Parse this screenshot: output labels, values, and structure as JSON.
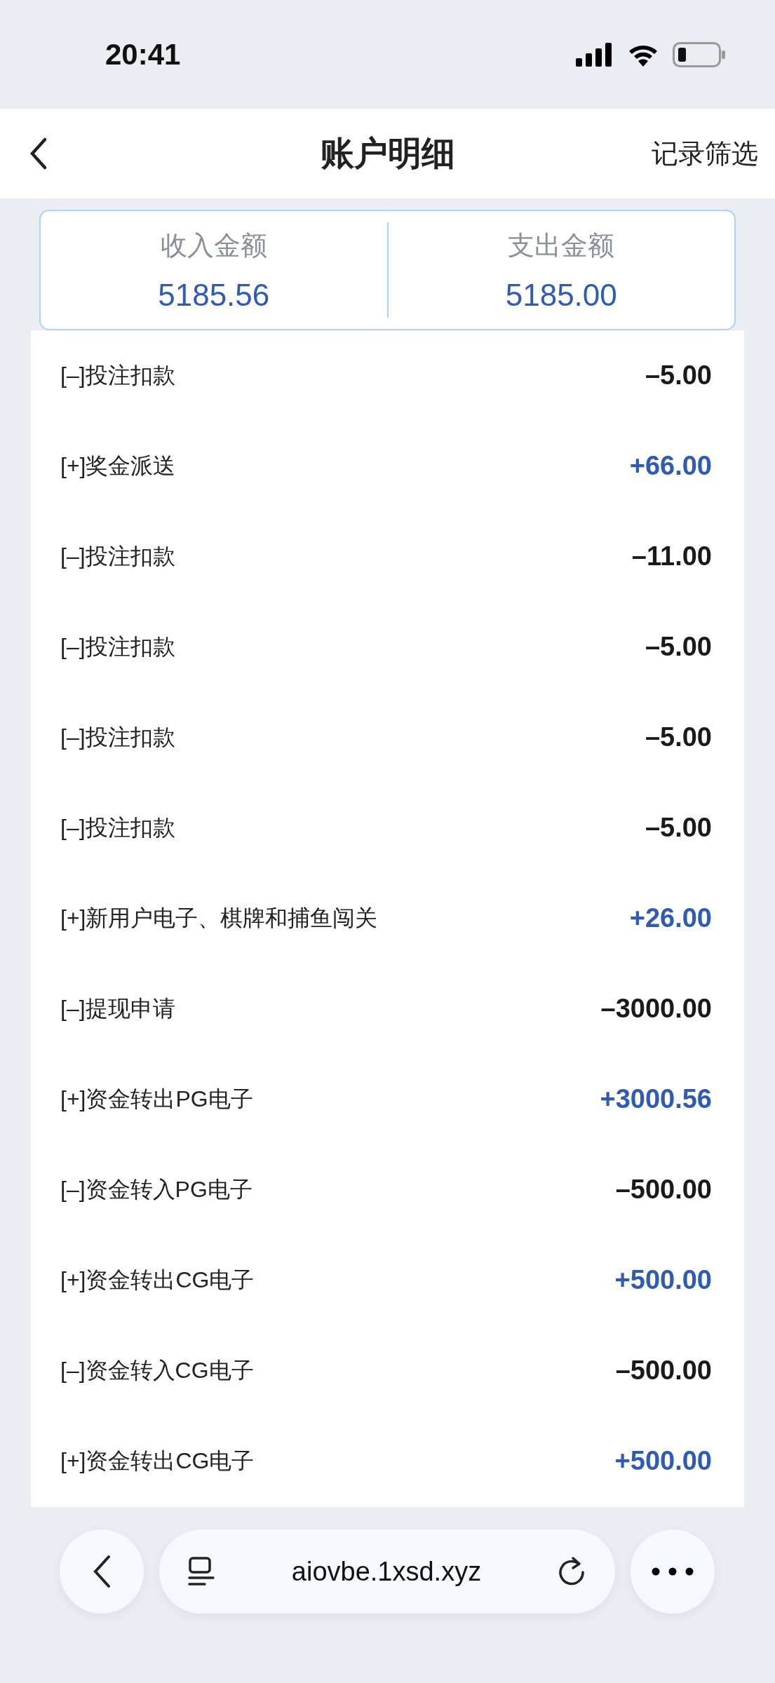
{
  "status_bar": {
    "time": "20:41"
  },
  "header": {
    "title": "账户明细",
    "action": "记录筛选"
  },
  "summary": [
    {
      "label": "收入金额",
      "value": "5185.56"
    },
    {
      "label": "支出金额",
      "value": "5185.00"
    }
  ],
  "records": [
    {
      "label": "[–]投注扣款",
      "amount": "–5.00",
      "kind": "debit"
    },
    {
      "label": "[+]奖金派送",
      "amount": "+66.00",
      "kind": "credit"
    },
    {
      "label": "[–]投注扣款",
      "amount": "–11.00",
      "kind": "debit"
    },
    {
      "label": "[–]投注扣款",
      "amount": "–5.00",
      "kind": "debit"
    },
    {
      "label": "[–]投注扣款",
      "amount": "–5.00",
      "kind": "debit"
    },
    {
      "label": "[–]投注扣款",
      "amount": "–5.00",
      "kind": "debit"
    },
    {
      "label": "[+]新用户电子、棋牌和捕鱼闯关",
      "amount": "+26.00",
      "kind": "credit"
    },
    {
      "label": "[–]提现申请",
      "amount": "–3000.00",
      "kind": "debit"
    },
    {
      "label": "[+]资金转出PG电子",
      "amount": "+3000.56",
      "kind": "credit"
    },
    {
      "label": "[–]资金转入PG电子",
      "amount": "–500.00",
      "kind": "debit"
    },
    {
      "label": "[+]资金转出CG电子",
      "amount": "+500.00",
      "kind": "credit"
    },
    {
      "label": "[–]资金转入CG电子",
      "amount": "–500.00",
      "kind": "debit"
    },
    {
      "label": "[+]资金转出CG电子",
      "amount": "+500.00",
      "kind": "credit"
    }
  ],
  "browser_bar": {
    "url": "aiovbe.1xsd.xyz"
  }
}
